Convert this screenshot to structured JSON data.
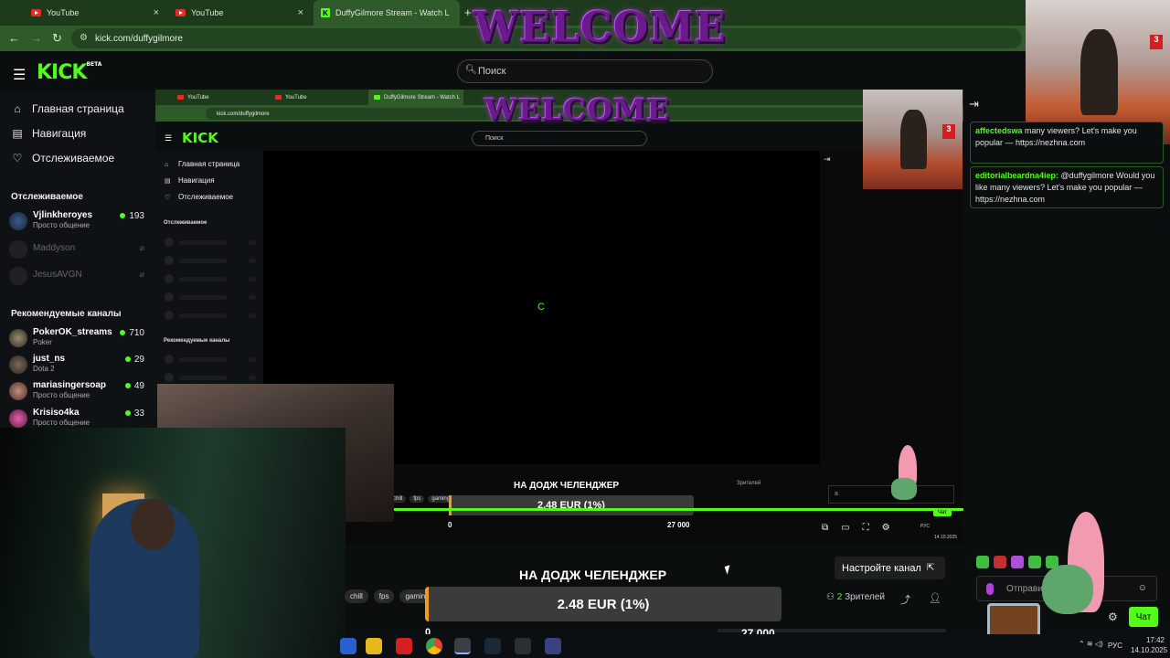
{
  "browser": {
    "tabs": [
      {
        "label": "YouTube"
      },
      {
        "label": "YouTube"
      },
      {
        "label": "DuffyGilmore Stream - Watch L"
      }
    ],
    "new_tab": "+",
    "url": "kick.com/duffygilmore",
    "back": "←",
    "forward": "→",
    "reload": "↻"
  },
  "kick": {
    "logo": "KICK",
    "beta": "BETA",
    "search_placeholder": "Поиск"
  },
  "overlay": {
    "welcome": "WELCOME"
  },
  "sidebar": {
    "nav": [
      {
        "label": "Главная страница",
        "icon": "home-icon"
      },
      {
        "label": "Навигация",
        "icon": "compass-icon"
      },
      {
        "label": "Отслеживаемое",
        "icon": "heart-icon"
      }
    ],
    "following_title": "Отслеживаемое",
    "following": [
      {
        "name": "Vjlinkheroyes",
        "category": "Просто общение",
        "viewers": "193",
        "live": true
      },
      {
        "name": "Maddyson",
        "category": "",
        "viewers": "",
        "live": false
      },
      {
        "name": "JesusAVGN",
        "category": "",
        "viewers": "",
        "live": false
      }
    ],
    "recommended_title": "Рекомендуемые каналы",
    "recommended": [
      {
        "name": "PokerOK_streams",
        "category": "Poker",
        "viewers": "710"
      },
      {
        "name": "just_ns",
        "category": "Dota 2",
        "viewers": "29"
      },
      {
        "name": "mariasingersoap",
        "category": "Просто общение",
        "viewers": "49"
      },
      {
        "name": "Krisiso4ka",
        "category": "Просто общение",
        "viewers": "33"
      }
    ]
  },
  "inner": {
    "tabs": [
      "YouTube",
      "YouTube",
      "DuffyGilmore Stream - Watch L"
    ],
    "url": "kick.com/duffygilmore",
    "search": "Поиск",
    "nav": [
      "Главная страница",
      "Навигация",
      "Отслеживаемое"
    ],
    "following_title": "Отслеживаемое",
    "recommended_title": "Рекомендуемые каналы",
    "loader": "C",
    "title": "НА ДОДЖ ЧЕЛЕНДЖЕР",
    "viewers": "Зрителей",
    "goal": "2.48 EUR (1%)",
    "goal_min": "0",
    "goal_max": "27 000",
    "tags": [
      "chill",
      "fps",
      "gaming"
    ],
    "input": "a",
    "chat_button": "Чат",
    "lang": "РУС",
    "date": "14.10.2025"
  },
  "chat": {
    "messages": [
      {
        "user": "affectedswa",
        "text": "many viewers? Let's make you popular — https://nezhna.com"
      },
      {
        "user": "editorialbeardna4iep:",
        "text": "@duffygilmore Would you like many viewers? Let's make you popular — https://nezhna.com"
      }
    ],
    "send_placeholder": "Отправить",
    "chat_button": "Чат"
  },
  "stream": {
    "title": "НА ДОДЖ ЧЕЛЕНДЖЕР",
    "tags": [
      "chill",
      "fps",
      "gaming"
    ],
    "goal_text": "2.48 EUR (1%)",
    "goal_progress": 0.01,
    "goal_min": "0",
    "goal_max": "27 000",
    "setup_button": "Настройте канал",
    "viewers_count": "2",
    "viewers_label": "Зрителей"
  },
  "taskbar": {
    "lang": "РУС",
    "time": "17:42",
    "date": "14.10.2025"
  },
  "colors": {
    "accent": "#53fc18",
    "browser": "#2f5a2a",
    "goal_fill": "#f29a1d"
  }
}
